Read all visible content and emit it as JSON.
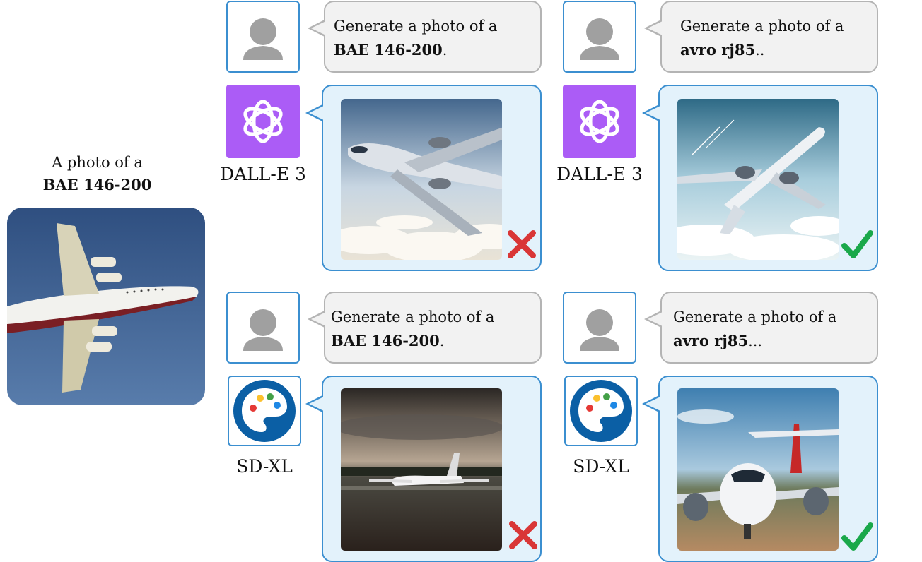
{
  "reference": {
    "caption_line1": "A photo of a",
    "caption_line2": "BAE 146-200"
  },
  "panels": [
    {
      "prompt_line1": "Generate a photo of a",
      "prompt_bold": "BAE 146-200",
      "prompt_suffix": ".",
      "model": "DALL-E 3",
      "logo": "openai-logo-icon",
      "verdict": "cross",
      "verdict_icon": "cross-icon"
    },
    {
      "prompt_line1": "Generate a photo of a",
      "prompt_bold": "avro rj85",
      "prompt_suffix": "..",
      "model": "DALL-E 3",
      "logo": "openai-logo-icon",
      "verdict": "check",
      "verdict_icon": "checkmark-icon"
    },
    {
      "prompt_line1": "Generate a photo of a",
      "prompt_bold": "BAE 146-200",
      "prompt_suffix": ".",
      "model": "SD-XL",
      "logo": "palette-logo-icon",
      "verdict": "cross",
      "verdict_icon": "cross-icon"
    },
    {
      "prompt_line1": "Generate a photo of a",
      "prompt_bold": "avro rj85",
      "prompt_suffix": "...",
      "model": "SD-XL",
      "logo": "palette-logo-icon",
      "verdict": "check",
      "verdict_icon": "checkmark-icon"
    }
  ],
  "colors": {
    "dalle_logo_bg": "#ab5cf6",
    "bubble_blue_border": "#3b8fd0",
    "bubble_blue_fill": "#e3f2fb",
    "bubble_gray_fill": "#f2f2f2",
    "cross": "#d93636",
    "check": "#1aa84a"
  }
}
